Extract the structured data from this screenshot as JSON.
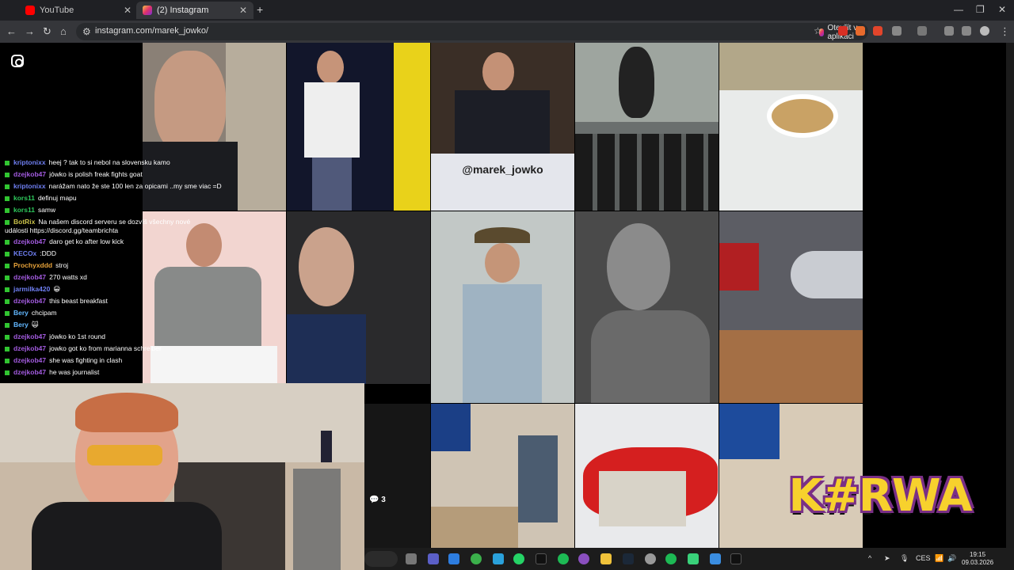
{
  "browser": {
    "tabs": [
      {
        "label": "YouTube",
        "favicon": "youtube-icon",
        "active": false
      },
      {
        "label": "(2) Instagram",
        "favicon": "instagram-icon",
        "active": true
      }
    ],
    "url": "instagram.com/marek_jowko/",
    "open_app_label": "Otevřít v aplikaci"
  },
  "instagram": {
    "handle_overlay": "@marek_jowko",
    "comment_count": "3"
  },
  "chat": {
    "messages": [
      {
        "user": "kriptonixx",
        "text": "heej ? tak to si nebol na slovensku kamo",
        "color": "#6f7ff2"
      },
      {
        "user": "dzejkob47",
        "text": "jówko is polish freak fights goat",
        "color": "#a35be0"
      },
      {
        "user": "kriptonixx",
        "text": "narážam nato že ste 100 len za opicami ..my sme viac =D",
        "color": "#6f7ff2"
      },
      {
        "user": "kors11",
        "text": "definuj mapu",
        "color": "#2ec95c"
      },
      {
        "user": "kors11",
        "text": "samw",
        "color": "#2ec95c"
      },
      {
        "user": "BotRix",
        "text": "Na našem discord serveru se dozvíš všechny nové",
        "color": "#c9c14a"
      },
      {
        "user": "",
        "text": "události https://discord.gg/teambrichta",
        "color": "#ffffff"
      },
      {
        "user": "dzejkob47",
        "text": "daro get ko after low kick",
        "color": "#a35be0"
      },
      {
        "user": "KECOx",
        "text": ":DDD",
        "color": "#6f7ff2"
      },
      {
        "user": "Prochyxddd",
        "text": "stroj",
        "color": "#e8a33a"
      },
      {
        "user": "dzejkob47",
        "text": "270 watts xd",
        "color": "#a35be0"
      },
      {
        "user": "jarmilka420",
        "text": "",
        "color": "#6f7ff2"
      },
      {
        "user": "dzejkob47",
        "text": "this beast breakfast",
        "color": "#a35be0"
      },
      {
        "user": "Bery",
        "text": "chcipam",
        "color": "#62b7ff"
      },
      {
        "user": "Bery",
        "text": "",
        "color": "#62b7ff"
      },
      {
        "user": "dzejkob47",
        "text": "jówko ko 1st round",
        "color": "#a35be0"
      },
      {
        "user": "dzejkob47",
        "text": "jowko got ko from marianna schreiber",
        "color": "#a35be0"
      },
      {
        "user": "dzejkob47",
        "text": "she was fighting in clash",
        "color": "#a35be0"
      },
      {
        "user": "dzejkob47",
        "text": "he was journalist",
        "color": "#a35be0"
      }
    ]
  },
  "overlay_logo": "K#RWA",
  "taskbar": {
    "language": "CES",
    "time": "19:15",
    "date": "09.03.2026"
  },
  "colors": {
    "chrome_bg": "#1f2024",
    "address_bg": "#35363a",
    "logo_yellow": "#f7d12d",
    "logo_purple": "#7a2f86",
    "chat_badge": "#31c531"
  }
}
